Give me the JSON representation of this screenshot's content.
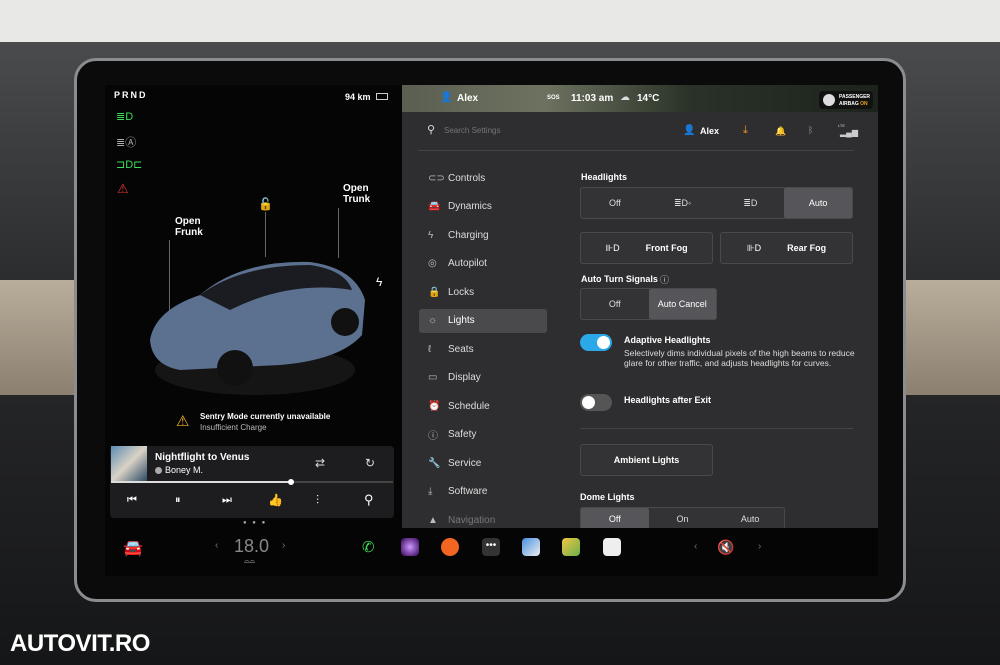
{
  "watermark": "AUTOVIT.RO",
  "left_panel": {
    "gear": "PRND",
    "range": "94 km",
    "open_frunk": "Open\nFrunk",
    "open_trunk": "Open\nTrunk",
    "alert_title": "Sentry Mode currently unavailable",
    "alert_sub": "Insufficient Charge"
  },
  "media": {
    "title": "Nightflight to Venus",
    "artist": "Boney M.",
    "progress": 0.64
  },
  "status_bar": {
    "user": "Alex",
    "sos": "SOS",
    "time": "11:03 am",
    "temp": "14°C",
    "airbag_1": "PASSENGER",
    "airbag_2": "AIRBAG",
    "airbag_state": "ON"
  },
  "settings_header": {
    "search_placeholder": "Search Settings",
    "user": "Alex",
    "lte": "LTE"
  },
  "nav": [
    {
      "label": "Controls",
      "icon": "⊂⊃"
    },
    {
      "label": "Dynamics",
      "icon": "🚘"
    },
    {
      "label": "Charging",
      "icon": "ϟ"
    },
    {
      "label": "Autopilot",
      "icon": "◎"
    },
    {
      "label": "Locks",
      "icon": "🔒"
    },
    {
      "label": "Lights",
      "icon": "☼"
    },
    {
      "label": "Seats",
      "icon": "ℓ"
    },
    {
      "label": "Display",
      "icon": "▭"
    },
    {
      "label": "Schedule",
      "icon": "⏰"
    },
    {
      "label": "Safety",
      "icon": "ⓘ"
    },
    {
      "label": "Service",
      "icon": "🔧"
    },
    {
      "label": "Software",
      "icon": "⤓"
    },
    {
      "label": "Navigation",
      "icon": "▲"
    }
  ],
  "lights": {
    "headlights_label": "Headlights",
    "headlights_options": [
      "Off",
      "≣D◦",
      "≣D",
      "Auto"
    ],
    "headlights_selected": "Auto",
    "front_fog": "Front Fog",
    "rear_fog": "Rear Fog",
    "turn_signals_label": "Auto Turn Signals",
    "turn_signals_options": [
      "Off",
      "Auto Cancel"
    ],
    "turn_signals_selected": "Auto Cancel",
    "adaptive_title": "Adaptive Headlights",
    "adaptive_desc": "Selectively dims individual pixels of the high beams to reduce glare for other traffic, and adjusts headlights for curves.",
    "adaptive_on": true,
    "after_exit": "Headlights after Exit",
    "after_exit_on": false,
    "ambient": "Ambient Lights",
    "dome_label": "Dome Lights",
    "dome_options": [
      "Off",
      "On",
      "Auto"
    ],
    "dome_selected": "Off"
  },
  "taskbar": {
    "temp": "18.0"
  },
  "colors": {
    "accent": "#2aa8e8",
    "download": "#f0a020",
    "warning": "#f5b82e",
    "green": "#3ddc5a"
  }
}
